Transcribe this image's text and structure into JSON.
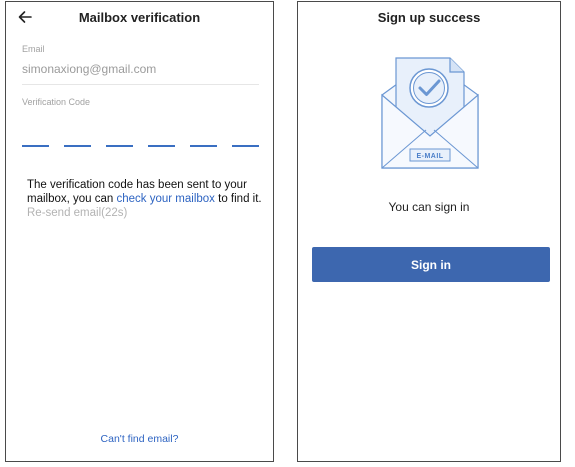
{
  "verification_screen": {
    "title": "Mailbox verification",
    "back_icon": "back-arrow-icon",
    "email": {
      "label": "Email",
      "value": "simonaxiong@gmail.com"
    },
    "code": {
      "label": "Verification Code",
      "digits": [
        "",
        "",
        "",
        "",
        "",
        ""
      ]
    },
    "message": {
      "text_before_link": "The verification code has been sent to your mailbox, you can ",
      "link_text": "check your mailbox",
      "text_after_link": " to find it. ",
      "resend_text": "Re-send email(22s)"
    },
    "cant_find_link": "Can't find email?"
  },
  "success_screen": {
    "title": "Sign up success",
    "illustration": {
      "icon": "email-check-icon",
      "label": "E-MAIL"
    },
    "message": "You can sign in",
    "sign_in_button": "Sign in"
  },
  "colors": {
    "accent_link": "#2e64c2",
    "button_bg": "#3d67af",
    "code_slot": "#3a6fc2",
    "illustration_fill": "#e8f0fb",
    "illustration_stroke": "#6b97d3"
  }
}
